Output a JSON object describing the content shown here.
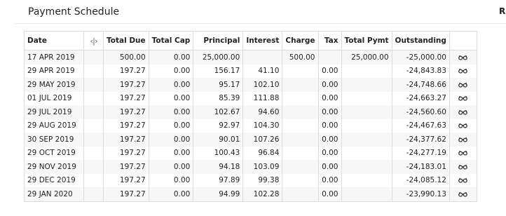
{
  "header": {
    "title": "Payment Schedule",
    "corner_label": "Re"
  },
  "table": {
    "columns": {
      "date": "Date",
      "toggle_icon": "code-toggle-icon",
      "total_due": "Total Due",
      "total_cap": "Total Cap",
      "principal": "Principal",
      "interest": "Interest",
      "charge": "Charge",
      "tax": "Tax",
      "total_pymt": "Total Pymt",
      "outstanding": "Outstanding"
    },
    "row_action_icon": "view-glasses-icon",
    "rows": [
      {
        "date": "17 APR 2019",
        "total_due": "500.00",
        "total_cap": "0.00",
        "principal": "25,000.00",
        "interest": "",
        "charge": "500.00",
        "tax": "",
        "total_pymt": "25,000.00",
        "outstanding": "-25,000.00"
      },
      {
        "date": "29 APR 2019",
        "total_due": "197.27",
        "total_cap": "0.00",
        "principal": "156.17",
        "interest": "41.10",
        "charge": "",
        "tax": "0.00",
        "total_pymt": "",
        "outstanding": "-24,843.83"
      },
      {
        "date": "29 MAY 2019",
        "total_due": "197.27",
        "total_cap": "0.00",
        "principal": "95.17",
        "interest": "102.10",
        "charge": "",
        "tax": "0.00",
        "total_pymt": "",
        "outstanding": "-24,748.66"
      },
      {
        "date": "01 JUL 2019",
        "total_due": "197.27",
        "total_cap": "0.00",
        "principal": "85.39",
        "interest": "111.88",
        "charge": "",
        "tax": "0.00",
        "total_pymt": "",
        "outstanding": "-24,663.27"
      },
      {
        "date": "29 JUL 2019",
        "total_due": "197.27",
        "total_cap": "0.00",
        "principal": "102.67",
        "interest": "94.60",
        "charge": "",
        "tax": "0.00",
        "total_pymt": "",
        "outstanding": "-24,560.60"
      },
      {
        "date": "29 AUG 2019",
        "total_due": "197.27",
        "total_cap": "0.00",
        "principal": "92.97",
        "interest": "104.30",
        "charge": "",
        "tax": "0.00",
        "total_pymt": "",
        "outstanding": "-24,467.63"
      },
      {
        "date": "30 SEP 2019",
        "total_due": "197.27",
        "total_cap": "0.00",
        "principal": "90.01",
        "interest": "107.26",
        "charge": "",
        "tax": "0.00",
        "total_pymt": "",
        "outstanding": "-24,377.62"
      },
      {
        "date": "29 OCT 2019",
        "total_due": "197.27",
        "total_cap": "0.00",
        "principal": "100.43",
        "interest": "96.84",
        "charge": "",
        "tax": "0.00",
        "total_pymt": "",
        "outstanding": "-24,277.19"
      },
      {
        "date": "29 NOV 2019",
        "total_due": "197.27",
        "total_cap": "0.00",
        "principal": "94.18",
        "interest": "103.09",
        "charge": "",
        "tax": "0.00",
        "total_pymt": "",
        "outstanding": "-24,183.01"
      },
      {
        "date": "29 DEC 2019",
        "total_due": "197.27",
        "total_cap": "0.00",
        "principal": "97.89",
        "interest": "99.38",
        "charge": "",
        "tax": "0.00",
        "total_pymt": "",
        "outstanding": "-24,085.12"
      },
      {
        "date": "29 JAN 2020",
        "total_due": "197.27",
        "total_cap": "0.00",
        "principal": "94.99",
        "interest": "102.28",
        "charge": "",
        "tax": "0.00",
        "total_pymt": "",
        "outstanding": "-23,990.13"
      }
    ]
  }
}
